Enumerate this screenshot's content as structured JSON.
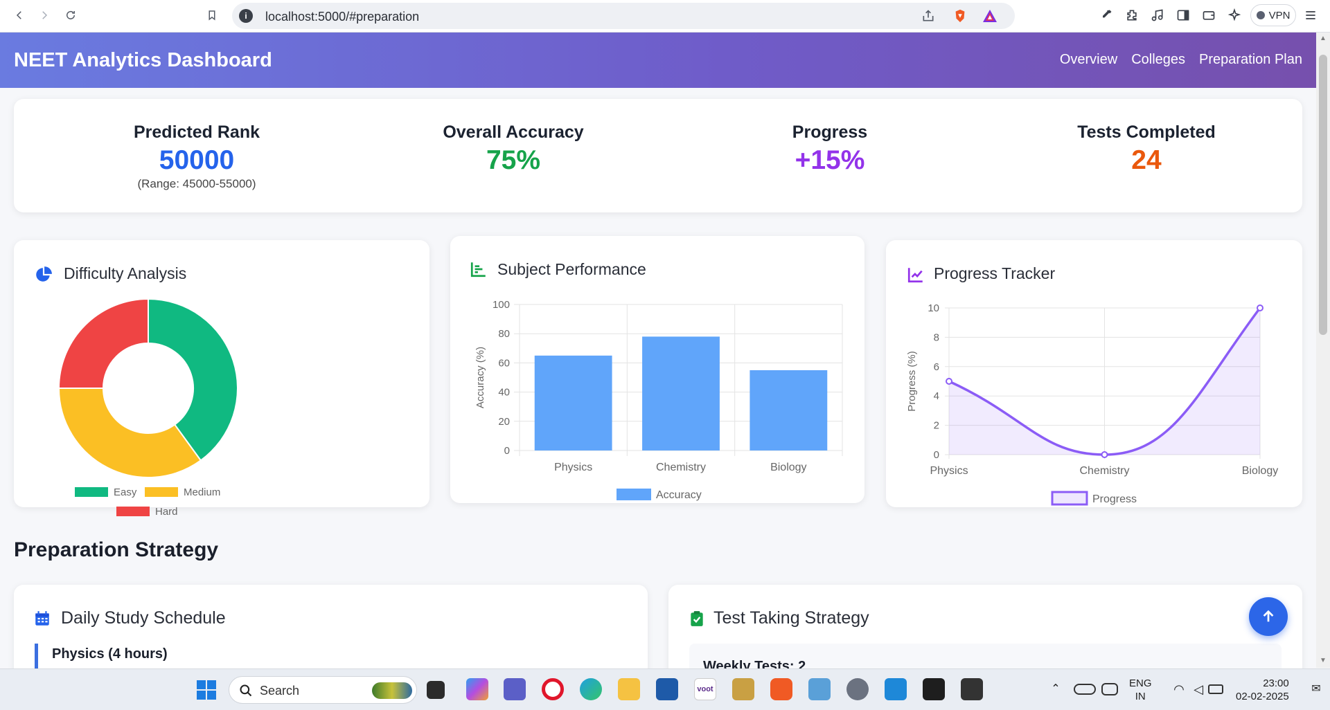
{
  "browser": {
    "url": "localhost:5000/#preparation",
    "vpn_label": "VPN"
  },
  "header": {
    "title": "NEET Analytics Dashboard",
    "nav": [
      "Overview",
      "Colleges",
      "Preparation Plan"
    ]
  },
  "stats": [
    {
      "label": "Predicted Rank",
      "value": "50000",
      "sub": "(Range: 45000-55000)",
      "color": "#2563eb"
    },
    {
      "label": "Overall Accuracy",
      "value": "75%",
      "sub": "",
      "color": "#16a34a"
    },
    {
      "label": "Progress",
      "value": "+15%",
      "sub": "",
      "color": "#9333ea"
    },
    {
      "label": "Tests Completed",
      "value": "24",
      "sub": "",
      "color": "#ea580c"
    }
  ],
  "cards": {
    "difficulty": {
      "title": "Difficulty Analysis"
    },
    "subject": {
      "title": "Subject Performance"
    },
    "progress": {
      "title": "Progress Tracker"
    }
  },
  "chart_data": [
    {
      "type": "pie",
      "categories": [
        "Easy",
        "Medium",
        "Hard"
      ],
      "values": [
        40,
        35,
        25
      ],
      "colors": [
        "#10b981",
        "#fbbf24",
        "#ef4444"
      ],
      "legend": "bottom"
    },
    {
      "type": "bar",
      "categories": [
        "Physics",
        "Chemistry",
        "Biology"
      ],
      "series": [
        {
          "name": "Accuracy",
          "values": [
            65,
            78,
            55
          ],
          "color": "#60a5fa"
        }
      ],
      "ylabel": "Accuracy (%)",
      "yticks": [
        0,
        20,
        40,
        60,
        80,
        100
      ],
      "ylim": [
        0,
        100
      ],
      "grid": true,
      "legend": "bottom"
    },
    {
      "type": "line",
      "categories": [
        "Physics",
        "Chemistry",
        "Biology"
      ],
      "series": [
        {
          "name": "Progress",
          "values": [
            5,
            0,
            10
          ],
          "color": "#8b5cf6"
        }
      ],
      "ylabel": "Progress (%)",
      "yticks": [
        0,
        2,
        4,
        6,
        8,
        10
      ],
      "ylim": [
        0,
        10
      ],
      "grid": true,
      "legend": "bottom"
    }
  ],
  "section": {
    "title": "Preparation Strategy",
    "schedule_title": "Daily Study Schedule",
    "schedule_first_item": "Physics (4 hours)",
    "strategy_title": "Test Taking Strategy",
    "strategy_first_item": "Weekly Tests: 2"
  },
  "taskbar": {
    "search_label": "Search",
    "lang_top": "ENG",
    "lang_bottom": "IN",
    "time": "23:00",
    "date": "02-02-2025"
  }
}
